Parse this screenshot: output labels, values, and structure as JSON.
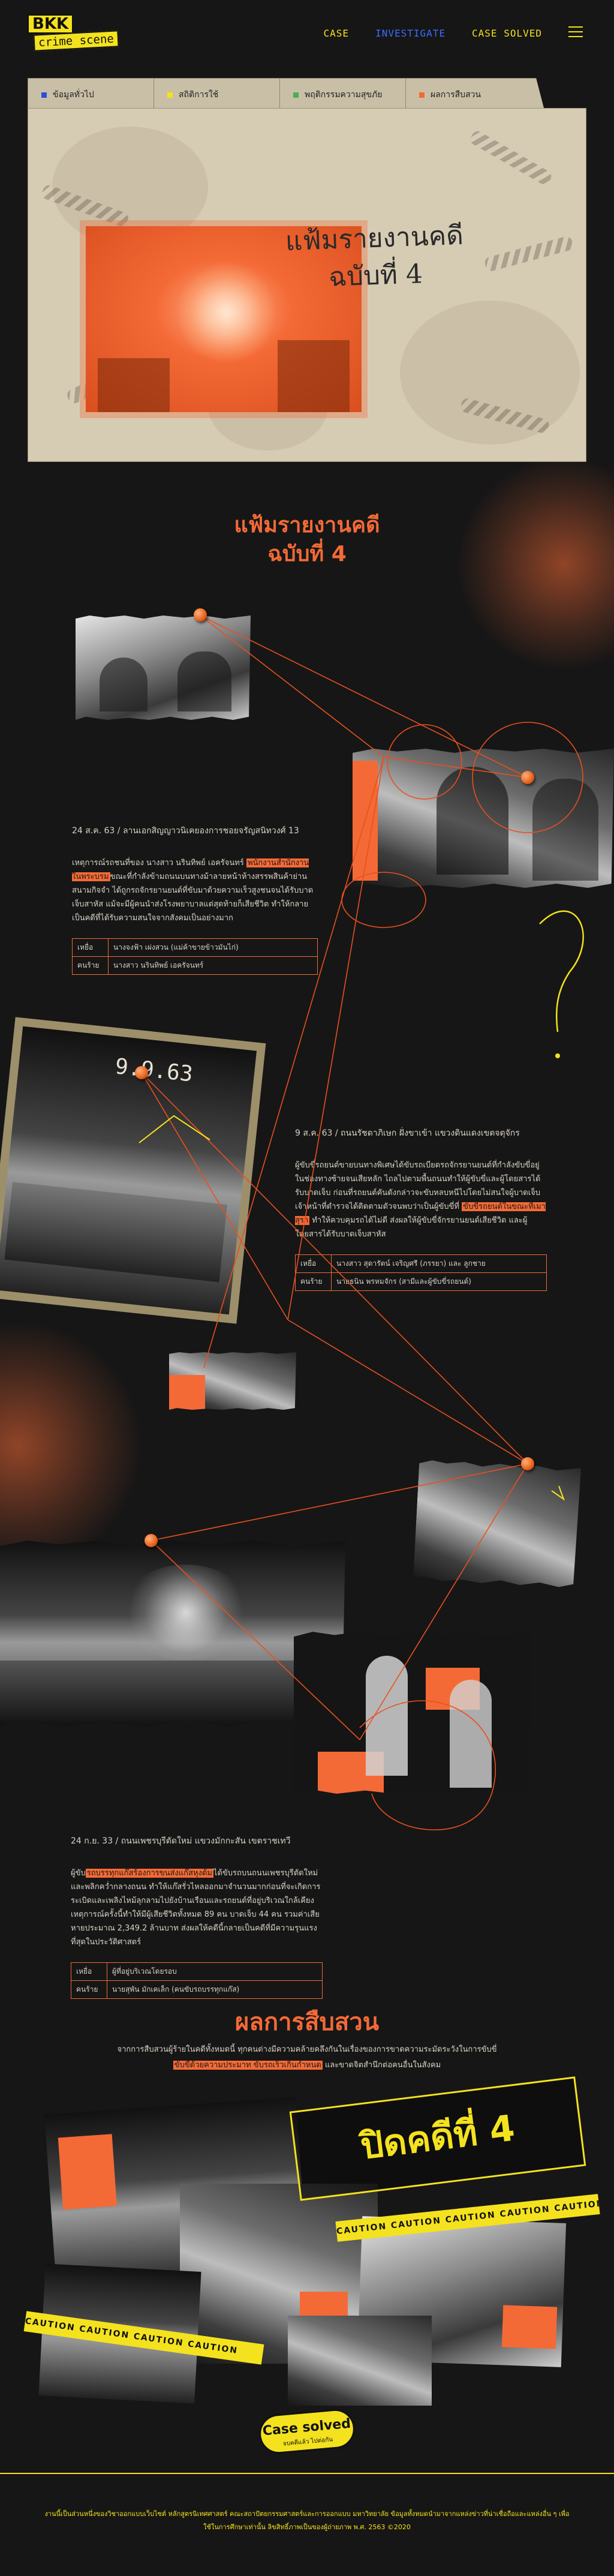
{
  "header": {
    "logo_line1": "BKK",
    "logo_line2": "crime scene",
    "nav": [
      {
        "label": "CASE",
        "active": false
      },
      {
        "label": "INVESTIGATE",
        "active": true
      },
      {
        "label": "CASE SOLVED",
        "active": false
      }
    ],
    "menu_icon": "hamburger-icon"
  },
  "folder": {
    "tabs": [
      {
        "label": "ข้อมูลทั่วไป",
        "color": "#2d4fd6"
      },
      {
        "label": "สถิติการใช้",
        "color": "#f4e21e"
      },
      {
        "label": "พฤติกรรมความสุขภัย",
        "color": "#4caf50"
      },
      {
        "label": "ผลการสืบสวน",
        "color": "#f46a36"
      }
    ],
    "title_line1": "แฟ้มรายงานคดี",
    "title_line2": "ฉบับที่ 4"
  },
  "section": {
    "title_line1": "แฟ้มรายงานคดี",
    "title_line2": "ฉบับที่ 4"
  },
  "cases": [
    {
      "date": "24 ส.ค. 63 / ลานเอกสิญญาวนิเคยองการชอยจรัญสนิทวงศ์ 13",
      "desc_pre": "เหตุการณ์รถชนที่ของ นางสาว นรินทิพย์ เอครัจนทร์ ",
      "desc_hl": "พนักงานสำนักงานในพระบรม",
      "desc_post": "ขณะที่กำลังข้ามถนนบนทางม้าลายหน้าห้างสรรพสินค้าย่านสนามกิจจำ ได้ถูกรถจักรยานยนต์ที่ขับมาด้วยความเร็วสูงชนจนได้รับบาดเจ็บสาหัส แม้จะมีผู้คนนำส่งโรงพยาบาลแต่สุดท้ายก็เสียชีวิต ทำให้กลายเป็นคดีที่ได้รับความสนใจจากสังคมเป็นอย่างมาก",
      "victim_label": "เหยื่อ",
      "victim": "นางจงฟ้า เผ่งสวน (แม่ค้าขายข้าวมันไก่)",
      "culprit_label": "คนร้าย",
      "culprit": "นางสาว นรินทิพย์ เอครัจนทร์"
    },
    {
      "date": "9 ส.ค. 63 / ถนนรัชดาภิเษก ฝั่งขาเข้า แขวงดินแดงเขตจตุจักร",
      "stamp": "9.9.63",
      "desc_pre": "ผู้ขับขี่รถยนต์ขายบนทางพิเศษได้ขับรถเบียดรถจักรยานยนต์ที่กำลังขับขี่อยู่ในช่องทางซ้ายจนเสียหลัก ไถลไปตามพื้นถนนทำให้ผู้ขับขี่และผู้โดยสารได้รับบาดเจ็บ ก่อนที่รถยนต์คันดังกล่าวจะขับหลบหนีไปโดยไม่สนใจผู้บาดเจ็บ เจ้าหน้าที่ตำรวจได้ติดตามตัวจนพบว่าเป็นผู้ขับขี่ที่ ",
      "desc_hl": "ขับขี่รถยนต์ในขณะที่เมาสุรา",
      "desc_post": " ทำให้ควบคุมรถได้ไม่ดี ส่งผลให้ผู้ขับขี่จักรยานยนต์เสียชีวิต และผู้โดยสารได้รับบาดเจ็บสาหัส",
      "victim_label": "เหยื่อ",
      "victim": "นางสาว สุดารัตน์ เจริญศรี (ภรรยา) และ ลูกชาย",
      "culprit_label": "คนร้าย",
      "culprit": "นายธนิน พรหมจักร (สามีและผู้ขับขี่รถยนต์)"
    },
    {
      "date": "24 ก.ย. 33 / ถนนเพชรบุรีตัดใหม่ แขวงมักกะสัน เขตราชเทวี",
      "desc_pre": "ผู้ขับ",
      "desc_hl": "รถบรรทุกแก๊สร้องการขนส่งแก๊สหุงต้ม",
      "desc_post": "ได้ขับรถบนถนนเพชรบุรีตัดใหม่และพลิกคว่ำกลางถนน ทำให้แก๊สรั่วไหลออกมาจำนวนมากก่อนที่จะเกิดการระเบิดและเพลิงไหม้ลุกลามไปยังบ้านเรือนและรถยนต์ที่อยู่บริเวณใกล้เคียง เหตุการณ์ครั้งนี้ทำให้มีผู้เสียชีวิตทั้งหมด 89 คน บาดเจ็บ 44 คน รวมค่าเสียหายประมาณ 2,349.2 ล้านบาท ส่งผลให้คดีนี้กลายเป็นคดีที่มีความรุนแรงที่สุดในประวัติศาสตร์",
      "victim_label": "เหยื่อ",
      "victim": "ผู้ที่อยู่บริเวณโดยรอบ",
      "culprit_label": "คนร้าย",
      "culprit": "นายสุพัน มักเคเล็ก (คนขับรถบรรทุกแก๊ส)"
    }
  ],
  "result": {
    "title": "ผลการสืบสวน",
    "text_pre": "จากการสืบสวนผู้ร้ายในคดีทั้งหมดนี้ ทุกคนต่างมีความคล้ายคลึงกันในเรื่องของการขาดความระมัดระวังในการขับขี่ ",
    "text_hl": "ขับขี่ด้วยความประมาท ขับรถเร็วเกินกำหนด",
    "text_post": " และขาดจิตสำนึกต่อคนอื่นในสังคม",
    "closed_banner": "ปิดคดีที่ 4",
    "caution1": "CAUTION CAUTION CAUTION CAUTION CAUTION",
    "caution2": "CAUTION CAUTION CAUTION CAUTION",
    "badge_line1": "Case solved",
    "badge_line2": "จบคดีแล้ว ไปต่อกัน"
  },
  "footer": {
    "text": "งานนี้เป็นส่วนหนึ่งของวิชาออกแบบเว็บไซต์ หลักสูตรนิเทศศาสตร์ คณะสถาปัตยกรรมศาสตร์และการออกแบบ มหาวิทยาลัย ข้อมูลทั้งหมดนำมาจากแหล่งข่าวที่น่าเชื่อถือและแหล่งอื่น ๆ เพื่อใช้ในการศึกษาเท่านั้น ลิขสิทธิ์ภาพเป็นของผู้ถ่ายภาพ พ.ศ. 2563 ©2020"
  },
  "colors": {
    "background": "#161616",
    "accent_yellow": "#f4e21e",
    "accent_orange": "#f46a36",
    "nav_active": "#3d6cff"
  }
}
